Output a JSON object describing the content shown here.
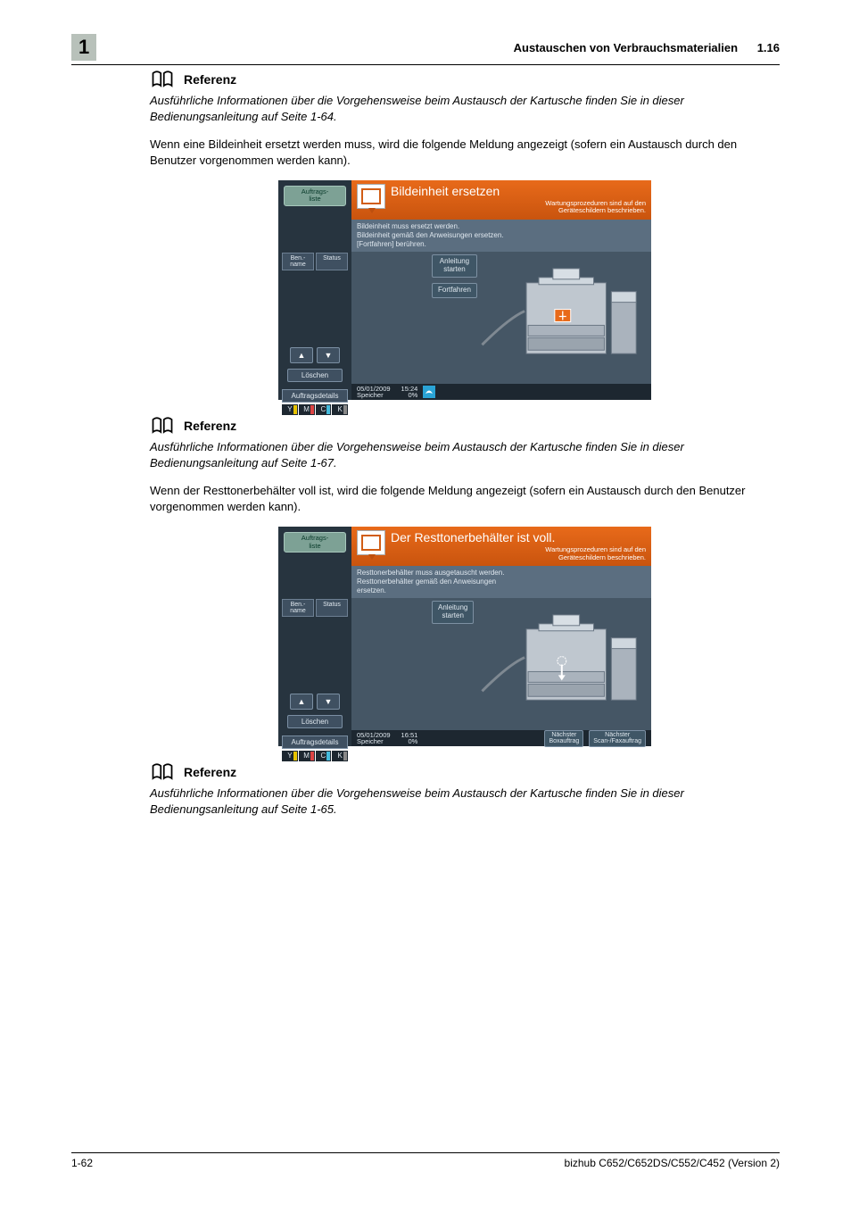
{
  "header": {
    "chapter": "1",
    "title": "Austauschen von Verbrauchsmaterialien",
    "section_num": "1.16"
  },
  "reference_label": "Referenz",
  "refs": {
    "r1": "Ausführliche Informationen über die Vorgehensweise beim Austausch der Kartusche finden Sie in dieser Bedienungsanleitung auf Seite 1-64.",
    "r2": "Ausführliche Informationen über die Vorgehensweise beim Austausch der Kartusche finden Sie in dieser Bedienungsanleitung auf Seite 1-67.",
    "r3": "Ausführliche Informationen über die Vorgehensweise beim Austausch der Kartusche finden Sie in dieser Bedienungsanleitung auf Seite 1-65."
  },
  "paras": {
    "p1": "Wenn eine Bildeinheit ersetzt werden muss, wird die folgende Meldung angezeigt (sofern ein Austausch durch den Benutzer vorgenommen werden kann).",
    "p2": "Wenn der Resttonerbehälter voll ist, wird die folgende Meldung angezeigt (sofern ein Austausch durch den Benutzer vorgenommen werden kann)."
  },
  "panel_common": {
    "job_list": "Auftrags-\nliste",
    "name": "Ben.-\nname",
    "status": "Status",
    "delete": "Löschen",
    "details": "Auftragsdetails",
    "instr": "Anleitung\nstarten",
    "continue": "Fortfahren",
    "orange_sub": "Wartungsprozeduren sind auf den\nGeräteschildern beschrieben.",
    "date": "05/01/2009",
    "mem": "Speicher",
    "pct": "0%",
    "next_box": "Nächster\nBoxauftrag",
    "next_scan": "Nächster\nScan-/Faxauftrag",
    "toners": {
      "y": "Y",
      "m": "M",
      "c": "C",
      "k": "K"
    }
  },
  "panel1": {
    "title": "Bildeinheit ersetzen",
    "msg": "Bildeinheit muss ersetzt werden.\nBildeinheit gemäß den Anweisungen ersetzen.\n[Fortfahren] berühren.",
    "time": "15:24"
  },
  "panel2": {
    "title": "Der Resttonerbehälter ist voll.",
    "msg": "Resttonerbehälter muss ausgetauscht werden.\nResttonerbehälter gemäß den Anweisungen\nersetzen.",
    "time": "16:51"
  },
  "footer": {
    "page": "1-62",
    "product": "bizhub C652/C652DS/C552/C452 (Version 2)"
  }
}
